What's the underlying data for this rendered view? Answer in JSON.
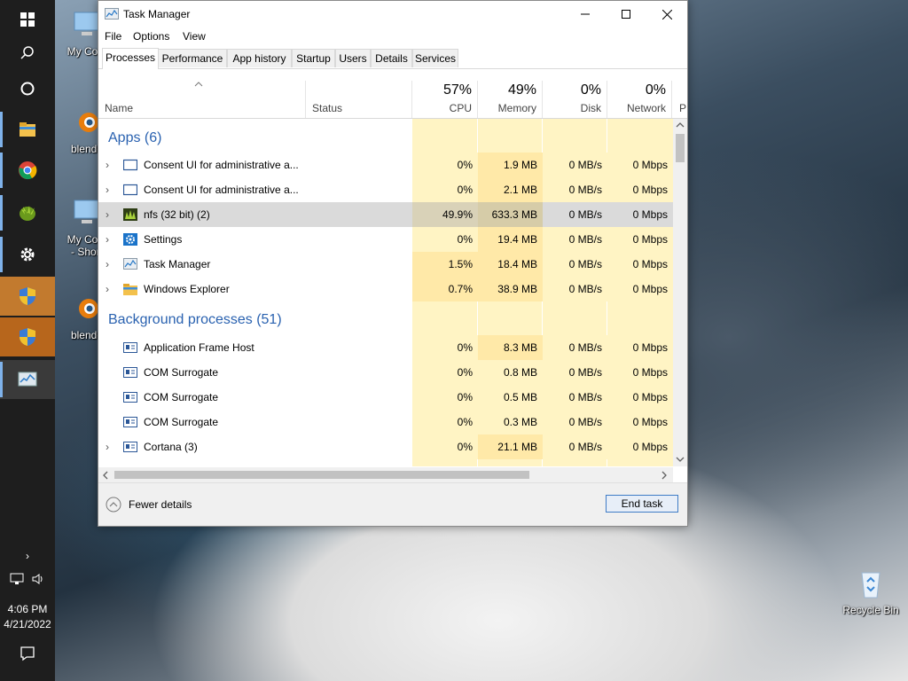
{
  "window": {
    "title": "Task Manager"
  },
  "menu": [
    "File",
    "Options",
    "View"
  ],
  "tabs": [
    "Processes",
    "Performance",
    "App history",
    "Startup",
    "Users",
    "Details",
    "Services"
  ],
  "columns": {
    "name": "Name",
    "status": "Status",
    "cpu": {
      "pct": "57%",
      "label": "CPU"
    },
    "memory": {
      "pct": "49%",
      "label": "Memory"
    },
    "disk": {
      "pct": "0%",
      "label": "Disk"
    },
    "network": {
      "pct": "0%",
      "label": "Network"
    },
    "power": {
      "label": "P"
    }
  },
  "groups": {
    "apps": "Apps (6)",
    "background": "Background processes (51)"
  },
  "apps": [
    {
      "name": "Consent UI for administrative a...",
      "cpu": "0%",
      "memory": "1.9 MB",
      "disk": "0 MB/s",
      "network": "0 Mbps",
      "icon": "window-icon"
    },
    {
      "name": "Consent UI for administrative a...",
      "cpu": "0%",
      "memory": "2.1 MB",
      "disk": "0 MB/s",
      "network": "0 Mbps",
      "icon": "window-icon"
    },
    {
      "name": "nfs (32 bit) (2)",
      "cpu": "49.9%",
      "memory": "633.3 MB",
      "disk": "0 MB/s",
      "network": "0 Mbps",
      "icon": "nfs-icon"
    },
    {
      "name": "Settings",
      "cpu": "0%",
      "memory": "19.4 MB",
      "disk": "0 MB/s",
      "network": "0 Mbps",
      "icon": "settings-icon"
    },
    {
      "name": "Task Manager",
      "cpu": "1.5%",
      "memory": "18.4 MB",
      "disk": "0 MB/s",
      "network": "0 Mbps",
      "icon": "task-manager-icon"
    },
    {
      "name": "Windows Explorer",
      "cpu": "0.7%",
      "memory": "38.9 MB",
      "disk": "0 MB/s",
      "network": "0 Mbps",
      "icon": "folder-icon"
    }
  ],
  "background": [
    {
      "name": "Application Frame Host",
      "cpu": "0%",
      "memory": "8.3 MB",
      "disk": "0 MB/s",
      "network": "0 Mbps"
    },
    {
      "name": "COM Surrogate",
      "cpu": "0%",
      "memory": "0.8 MB",
      "disk": "0 MB/s",
      "network": "0 Mbps"
    },
    {
      "name": "COM Surrogate",
      "cpu": "0%",
      "memory": "0.5 MB",
      "disk": "0 MB/s",
      "network": "0 Mbps"
    },
    {
      "name": "COM Surrogate",
      "cpu": "0%",
      "memory": "0.3 MB",
      "disk": "0 MB/s",
      "network": "0 Mbps"
    },
    {
      "name": "Cortana (3)",
      "cpu": "0%",
      "memory": "21.1 MB",
      "disk": "0 MB/s",
      "network": "0 Mbps"
    }
  ],
  "footer": {
    "fewer_details": "Fewer details",
    "end_task": "End task"
  },
  "desktop_icons": [
    "My Com",
    "blende",
    "My Com\n- Short",
    "blende",
    "Recycle Bin"
  ],
  "clock": {
    "time": "4:06 PM",
    "date": "4/21/2022"
  }
}
